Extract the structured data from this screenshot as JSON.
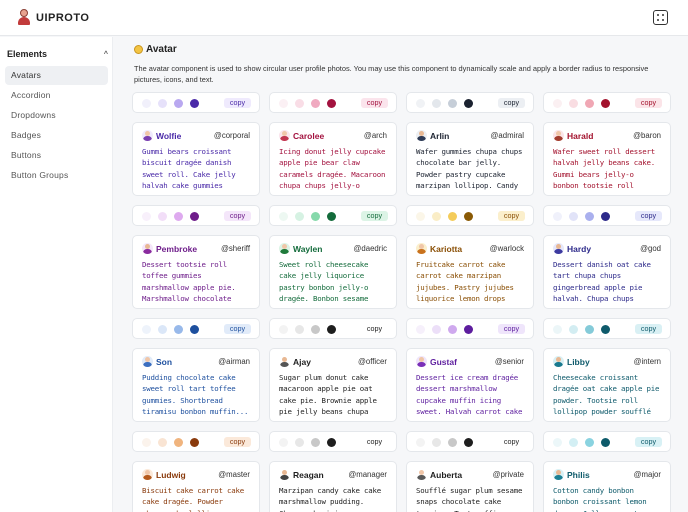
{
  "app": {
    "name": "UIPROTO"
  },
  "sidebar": {
    "heading": "Elements",
    "items": [
      {
        "label": "Avatars",
        "active": true
      },
      {
        "label": "Accordion",
        "active": false
      },
      {
        "label": "Dropdowns",
        "active": false
      },
      {
        "label": "Badges",
        "active": false
      },
      {
        "label": "Buttons",
        "active": false
      },
      {
        "label": "Button Groups",
        "active": false
      }
    ]
  },
  "page": {
    "title": "Avatar",
    "description": "The avatar component is used to show circular user profile photos. You may use this component to dynamically scale and apply a border radius to responsive pictures, icons, and text."
  },
  "copy_label": "copy",
  "cards": [
    {
      "name": "Wolfie",
      "handle": "@corporal",
      "text": "Gummi bears croissant biscuit dragée danish sweet roll. Cake jelly halvah cake gummies tiramisu cupcake...",
      "swatches": [
        "#f1f0fb",
        "#e6e1fa",
        "#b9a8f0",
        "#4a2aa8"
      ],
      "accent": "#4a2aa8",
      "copy_bg": "#efeafd",
      "avatar_head": "#f0c6a8",
      "avatar_body": "#7a3fb0"
    },
    {
      "name": "Carolee",
      "handle": "@arch",
      "text": "Icing donut jelly cupcake apple pie bear claw caramels dragée. Macaroon chupa chups jelly-o sweet...",
      "swatches": [
        "#fbf0f4",
        "#f9dde6",
        "#f0a9c0",
        "#a3123f"
      ],
      "accent": "#a3123f",
      "copy_bg": "#fbe4ec",
      "avatar_head": "#f0c6a8",
      "avatar_body": "#c2344f"
    },
    {
      "name": "Arlin",
      "handle": "@admiral",
      "text": "Wafer gummies chupa chups chocolate bar jelly. Powder pastry cupcake marzipan lollipop. Candy wafer...",
      "swatches": [
        "#f0f2f5",
        "#e3e7ec",
        "#c6ced8",
        "#1b2230"
      ],
      "accent": "#1b2230",
      "copy_bg": "#eceff3",
      "avatar_head": "#e8b893",
      "avatar_body": "#2d3a55"
    },
    {
      "name": "Harald",
      "handle": "@baron",
      "text": "Wafer sweet roll dessert halvah jelly beans cake. Gummi bears jelly-o bonbon tootsie roll chocolate pastry...",
      "swatches": [
        "#fbf0f2",
        "#f9dde2",
        "#f0a7b4",
        "#a3122d"
      ],
      "accent": "#a3122d",
      "copy_bg": "#fbe4e8",
      "avatar_head": "#f0c6a8",
      "avatar_body": "#a33c2d"
    },
    {
      "name": "Pembroke",
      "handle": "@sheriff",
      "text": "Dessert tootsie roll toffee gummies marshmallow apple pie. Marshmallow chocolate cake candy dragée oat cak...",
      "swatches": [
        "#f8f0fb",
        "#f2def8",
        "#deaaef",
        "#6e1d8a"
      ],
      "accent": "#6e1d8a",
      "copy_bg": "#f4e6fa",
      "avatar_head": "#e8b893",
      "avatar_body": "#8a2b9e"
    },
    {
      "name": "Waylen",
      "handle": "@daedric",
      "text": "Sweet roll cheesecake cake jelly liquorice pastry bonbon jelly-o dragée. Bonbon sesame snaps liquorice cak...",
      "swatches": [
        "#edf8f2",
        "#d6f2e3",
        "#86d9ab",
        "#136b3b"
      ],
      "accent": "#136b3b",
      "copy_bg": "#dcf4e6",
      "avatar_head": "#f0c6a8",
      "avatar_body": "#1f7a3a"
    },
    {
      "name": "Kariotta",
      "handle": "@warlock",
      "text": "Fruitcake carrot cake carrot cake marzipan jujubes. Pastry jujubes liquorice lemon drops cotton candy...",
      "swatches": [
        "#fbf6e8",
        "#faedc6",
        "#f4cc5a",
        "#8a5a05"
      ],
      "accent": "#8a4f05",
      "copy_bg": "#fbefcc",
      "avatar_head": "#f0c6a8",
      "avatar_body": "#c9721d"
    },
    {
      "name": "Hardy",
      "handle": "@god",
      "text": "Dessert danish oat cake tart chupa chups gingerbread apple pie halvah. Chupa chups dessert bear claw...",
      "swatches": [
        "#f0f1fb",
        "#e1e3f8",
        "#aab0ee",
        "#2d2a8a"
      ],
      "accent": "#2d2a8a",
      "copy_bg": "#e6e8fb",
      "avatar_head": "#e8b893",
      "avatar_body": "#3d3aa0"
    },
    {
      "name": "Son",
      "handle": "@airman",
      "text": "Pudding chocolate cake sweet roll tart toffee gummies. Shortbread tiramisu bonbon muffin...",
      "swatches": [
        "#eef3fb",
        "#dbe7f8",
        "#98b9ea",
        "#1d4f9e"
      ],
      "accent": "#1d4f9e",
      "copy_bg": "#e1ebf9",
      "avatar_head": "#f0c6a8",
      "avatar_body": "#3c6fc0"
    },
    {
      "name": "Ajay",
      "handle": "@officer",
      "text": "Sugar plum donut cake macaroon apple pie oat cake pie. Brownie apple pie jelly beans chupa chups...",
      "swatches": [
        "#f3f3f3",
        "#e7e7e7",
        "#c8c8c8",
        "#1e1e1e"
      ],
      "accent": "#1e1e1e",
      "copy_bg": "#ffffff",
      "avatar_head": "#e8b893",
      "avatar_body": "#555555"
    },
    {
      "name": "Gustaf",
      "handle": "@senior",
      "text": "Dessert ice cream dragée dessert marshmallow cupcake muffin icing sweet. Halvah carrot cake muffin...",
      "swatches": [
        "#f6f0fb",
        "#ecdff8",
        "#cfa9ee",
        "#5d1d9e"
      ],
      "accent": "#5d1d9e",
      "copy_bg": "#efe5fb",
      "avatar_head": "#f0c6a8",
      "avatar_body": "#7a2fb8"
    },
    {
      "name": "Libby",
      "handle": "@intern",
      "text": "Cheesecake croissant dragée oat cake apple pie powder. Tootsie roll lollipop powder soufflé brownie...",
      "swatches": [
        "#ecf6f8",
        "#d3edf2",
        "#85cbd9",
        "#0e5a6b"
      ],
      "accent": "#0e5a6b",
      "copy_bg": "#d9f0f4",
      "avatar_head": "#e8b893",
      "avatar_body": "#1a7a8f"
    },
    {
      "name": "Ludwig",
      "handle": "@master",
      "text": "Biscuit cake carrot cake cake dragée. Powder cheesecake lollipop cake...",
      "swatches": [
        "#fbf3ec",
        "#f9e4d3",
        "#f0b47e",
        "#8a3b0d"
      ],
      "accent": "#8a3b0d",
      "copy_bg": "#fbe9da",
      "avatar_head": "#f0c6a8",
      "avatar_body": "#b55a1d"
    },
    {
      "name": "Reagan",
      "handle": "@manager",
      "text": "Marzipan candy cake cake marshmallow pudding. Cheesecake icing...",
      "swatches": [
        "#f3f3f3",
        "#e7e7e7",
        "#c8c8c8",
        "#1e1e1e"
      ],
      "accent": "#1e1e1e",
      "copy_bg": "#ffffff",
      "avatar_head": "#e8b893",
      "avatar_body": "#444444"
    },
    {
      "name": "Auberta",
      "handle": "@private",
      "text": "Soufflé sugar plum sesame snaps chocolate cake topping. Tart muffin jelly...",
      "swatches": [
        "#f3f3f3",
        "#e7e7e7",
        "#c8c8c8",
        "#1e1e1e"
      ],
      "accent": "#1e1e1e",
      "copy_bg": "#ffffff",
      "avatar_head": "#f0c6a8",
      "avatar_body": "#5a5a5a"
    },
    {
      "name": "Philis",
      "handle": "@major",
      "text": "Cotton candy bonbon bonbon croissant lemon drops. Jelly-o sweet roll...",
      "swatches": [
        "#ecf7f9",
        "#d3eff4",
        "#8ad3e0",
        "#0d5a6a"
      ],
      "accent": "#0d5a6a",
      "copy_bg": "#d8f1f5",
      "avatar_head": "#e8b893",
      "avatar_body": "#1c8094"
    }
  ]
}
